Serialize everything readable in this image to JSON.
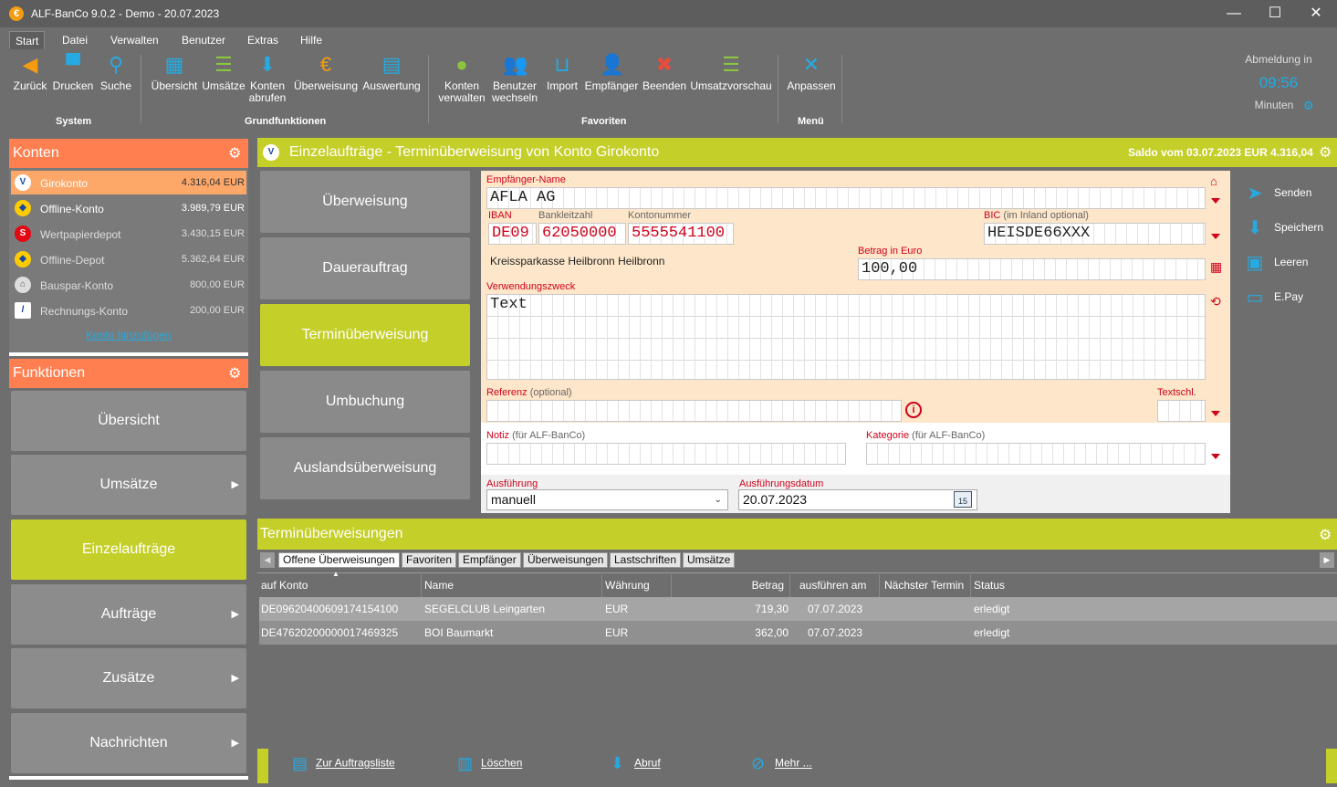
{
  "window": {
    "title": "ALF-BanCo 9.0.2 - Demo  -  20.07.2023",
    "minimize": "—",
    "maximize": "☐",
    "close": "✕"
  },
  "menu": [
    "Start",
    "Datei",
    "Verwalten",
    "Benutzer",
    "Extras",
    "Hilfe"
  ],
  "ribbon": {
    "system": {
      "label": "System",
      "buttons": [
        "Zurück",
        "Drucken",
        "Suche"
      ]
    },
    "grundfunktionen": {
      "label": "Grundfunktionen",
      "buttons": [
        "Übersicht",
        "Umsätze",
        "Konten abrufen",
        "Überweisung",
        "Auswertung"
      ]
    },
    "favoriten": {
      "label": "Favoriten",
      "buttons": [
        "Konten verwalten",
        "Benutzer wechseln",
        "Import",
        "Empfänger",
        "Beenden",
        "Umsatzvorschau"
      ]
    },
    "menu": {
      "label": "Menü",
      "buttons": [
        "Anpassen"
      ]
    },
    "logout": {
      "label": "Abmeldung in",
      "time": "09:56",
      "unit": "Minuten"
    }
  },
  "konten": {
    "title": "Konten",
    "add_link": "Konto hinzufügen",
    "accounts": [
      {
        "name": "Girokonto",
        "balance": "4.316,04 EUR",
        "icon": "volksbank-icon"
      },
      {
        "name": "Offline-Konto",
        "balance": "3.989,79 EUR",
        "icon": "commerzbank-icon"
      },
      {
        "name": "Wertpapierdepot",
        "balance": "3.430,15 EUR",
        "icon": "sparkasse-icon"
      },
      {
        "name": "Offline-Depot",
        "balance": "5.362,64 EUR",
        "icon": "commerzbank-icon"
      },
      {
        "name": "Bauspar-Konto",
        "balance": "800,00 EUR",
        "icon": "bank-building-icon"
      },
      {
        "name": "Rechnungs-Konto",
        "balance": "200,00 EUR",
        "icon": "deutsche-bank-icon"
      }
    ]
  },
  "funktionen": {
    "title": "Funktionen",
    "items": [
      "Übersicht",
      "Umsätze",
      "Einzelaufträge",
      "Aufträge",
      "Zusätze",
      "Nachrichten"
    ]
  },
  "main": {
    "title": "Einzelaufträge - Terminüberweisung von Konto Girokonto",
    "saldo": "Saldo vom 03.07.2023 EUR 4.316,04"
  },
  "order_types": [
    "Überweisung",
    "Dauerauftrag",
    "Terminüberweisung",
    "Umbuchung",
    "Auslandsüberweisung"
  ],
  "form": {
    "empfaenger_label": "Empfänger-Name",
    "empfaenger_value": "AFLA AG",
    "iban_label": "IBAN",
    "iban_prefix": "DE09",
    "blz_label": "Bankleitzahl",
    "blz_value": "62050000",
    "konto_label": "Kontonummer",
    "konto_value": "5555541100",
    "bic_label": "BIC",
    "bic_sub": "(im Inland optional)",
    "bic_value": "HEISDE66XXX",
    "bank_name": "Kreissparkasse Heilbronn Heilbronn",
    "betrag_label": "Betrag in Euro",
    "betrag_value": "100,00",
    "zweck_label": "Verwendungszweck",
    "zweck_value": "Text",
    "referenz_label": "Referenz",
    "referenz_sub": "(optional)",
    "textschl_label": "Textschl.",
    "notiz_label": "Notiz",
    "notiz_sub": "(für ALF-BanCo)",
    "kategorie_label": "Kategorie",
    "kategorie_sub": "(für ALF-BanCo)",
    "ausfuehrung_label": "Ausführung",
    "ausfuehrung_value": "manuell",
    "datum_label": "Ausführungsdatum",
    "datum_value": "20.07.2023",
    "cal_day": "15"
  },
  "actions": [
    "Senden",
    "Speichern",
    "Leeren",
    "E.Pay"
  ],
  "lower": {
    "title": "Terminüberweisungen",
    "tabs": [
      "Offene Überweisungen",
      "Favoriten",
      "Empfänger",
      "Überweisungen",
      "Lastschriften",
      "Umsätze"
    ],
    "columns": [
      "auf Konto",
      "Name",
      "Währung",
      "Betrag",
      "ausführen am",
      "Nächster Termin",
      "Status"
    ],
    "rows": [
      [
        "DE09620400609174154100",
        "SEGELCLUB Leingarten",
        "EUR",
        "719,30",
        "07.07.2023",
        "",
        "erledigt"
      ],
      [
        "DE47620200000017469325",
        "BOI Baumarkt",
        "EUR",
        "362,00",
        "07.07.2023",
        "",
        "erledigt"
      ]
    ],
    "bottom_actions": [
      "Zur Auftragsliste",
      "Löschen",
      "Abruf",
      "Mehr ..."
    ]
  },
  "colors": {
    "accent": "#c5cf2a",
    "orange": "#ff7f50",
    "blue": "#27aae1",
    "form_bg": "#fde6c9"
  }
}
